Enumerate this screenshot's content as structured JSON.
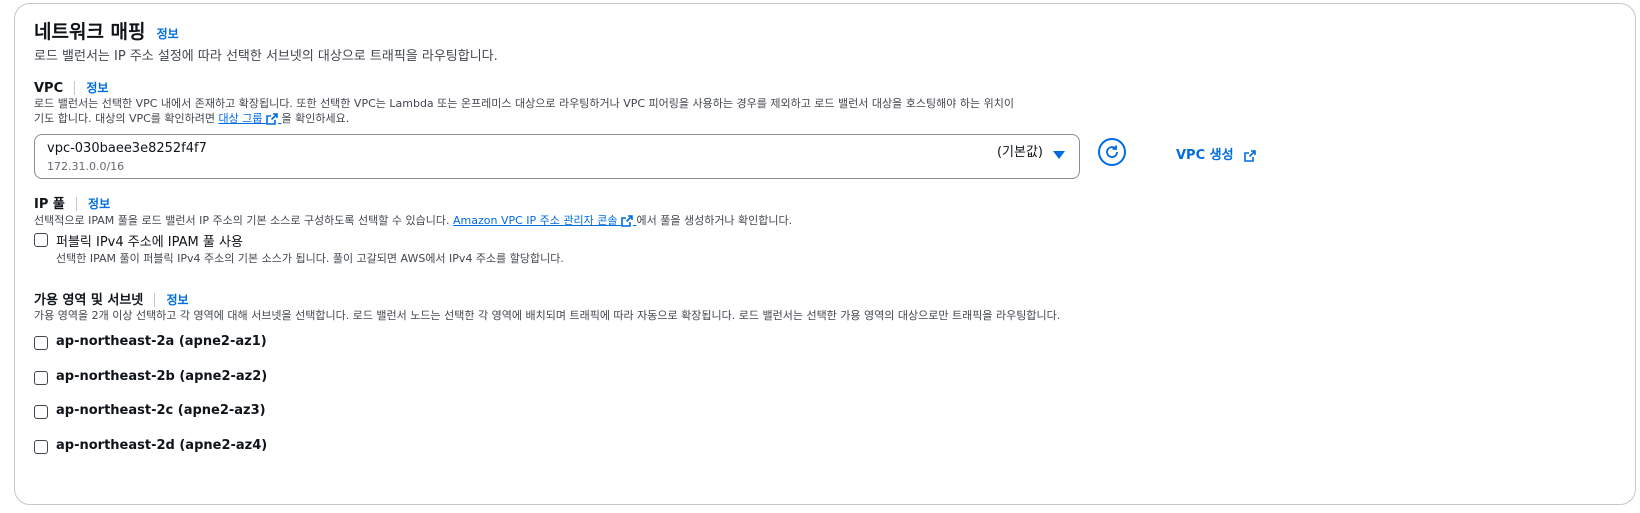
{
  "section": {
    "title": "네트워크 매핑",
    "info": "정보",
    "description": "로드 밸런서는 IP 주소 설정에 따라 선택한 서브넷의 대상으로 트래픽을 라우팅합니다."
  },
  "vpc": {
    "label": "VPC",
    "info": "정보",
    "desc_line1": "로드 밸런서는 선택한 VPC 내에서 존재하고 확장됩니다. 또한 선택한 VPC는 Lambda 또는 온프레미스 대상으로 라우팅하거나 VPC 피어링을 사용하는 경우를 제외하고 로드 밸런서 대상을 호스팅해야 하는 위치이",
    "desc_line2_prefix": "기도 합니다. 대상의 VPC를 확인하려면",
    "desc_link": "대상 그룹",
    "desc_line2_suffix": "을 확인하세요.",
    "selected_value": "vpc-030baee3e8252f4f7",
    "selected_cidr": "172.31.0.0/16",
    "default_tag": "(기본값)",
    "create_label": "VPC 생성"
  },
  "ip_pool": {
    "label": "IP 풀",
    "info": "정보",
    "desc_prefix": "선택적으로 IPAM 풀을 로드 밸런서 IP 주소의 기본 소스로 구성하도록 선택할 수 있습니다.",
    "desc_link": "Amazon VPC IP 주소 관리자 콘솔",
    "desc_suffix": "에서 풀을 생성하거나 확인합니다.",
    "checkbox_label": "퍼블릭 IPv4 주소에 IPAM 풀 사용",
    "checkbox_checked": false,
    "checkbox_desc": "선택한 IPAM 풀이 퍼블릭 IPv4 주소의 기본 소스가 됩니다. 풀이 고갈되면 AWS에서 IPv4 주소를 할당합니다."
  },
  "az": {
    "label": "가용 영역 및 서브넷",
    "info": "정보",
    "description": "가용 영역을 2개 이상 선택하고 각 영역에 대해 서브넷을 선택합니다. 로드 밸런서 노드는 선택한 각 영역에 배치되며 트래픽에 따라 자동으로 확장됩니다. 로드 밸런서는 선택한 가용 영역의 대상으로만 트래픽을 라우팅합니다.",
    "zones": [
      {
        "label": "ap-northeast-2a (apne2-az1)",
        "checked": false
      },
      {
        "label": "ap-northeast-2b (apne2-az2)",
        "checked": false
      },
      {
        "label": "ap-northeast-2c (apne2-az3)",
        "checked": false
      },
      {
        "label": "ap-northeast-2d (apne2-az4)",
        "checked": false
      }
    ]
  },
  "colors": {
    "link": "#006ce0",
    "text": "#0f141a",
    "muted": "#424650",
    "border": "#c6c6cd"
  },
  "icons": {
    "external": "external-link-icon",
    "refresh": "refresh-icon",
    "caret": "caret-down-icon"
  }
}
